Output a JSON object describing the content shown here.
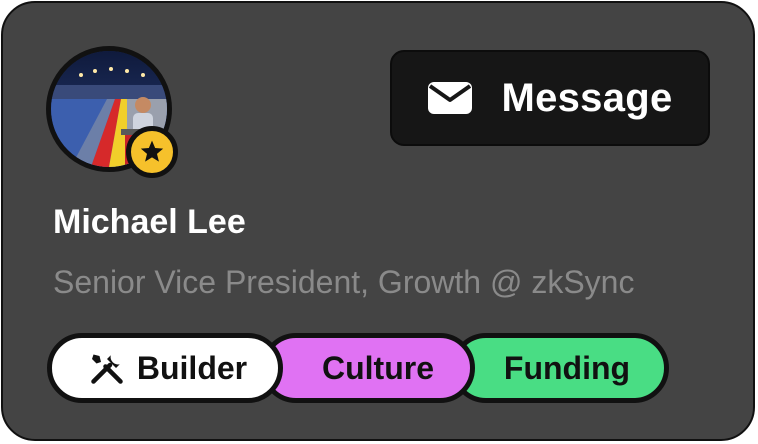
{
  "profile": {
    "name": "Michael Lee",
    "title": "Senior Vice President, Growth @ zkSync",
    "avatar_icon": "profile-photo",
    "badge_icon": "star-icon"
  },
  "actions": {
    "message_label": "Message",
    "message_icon": "envelope-icon"
  },
  "tags": [
    {
      "label": "Builder",
      "icon": "tools-icon",
      "color": "#ffffff"
    },
    {
      "label": "Culture",
      "color": "#e072f3"
    },
    {
      "label": "Funding",
      "color": "#49dd84"
    }
  ],
  "colors": {
    "card_background": "#444444",
    "badge": "#f6c12b",
    "button": "#161616"
  }
}
